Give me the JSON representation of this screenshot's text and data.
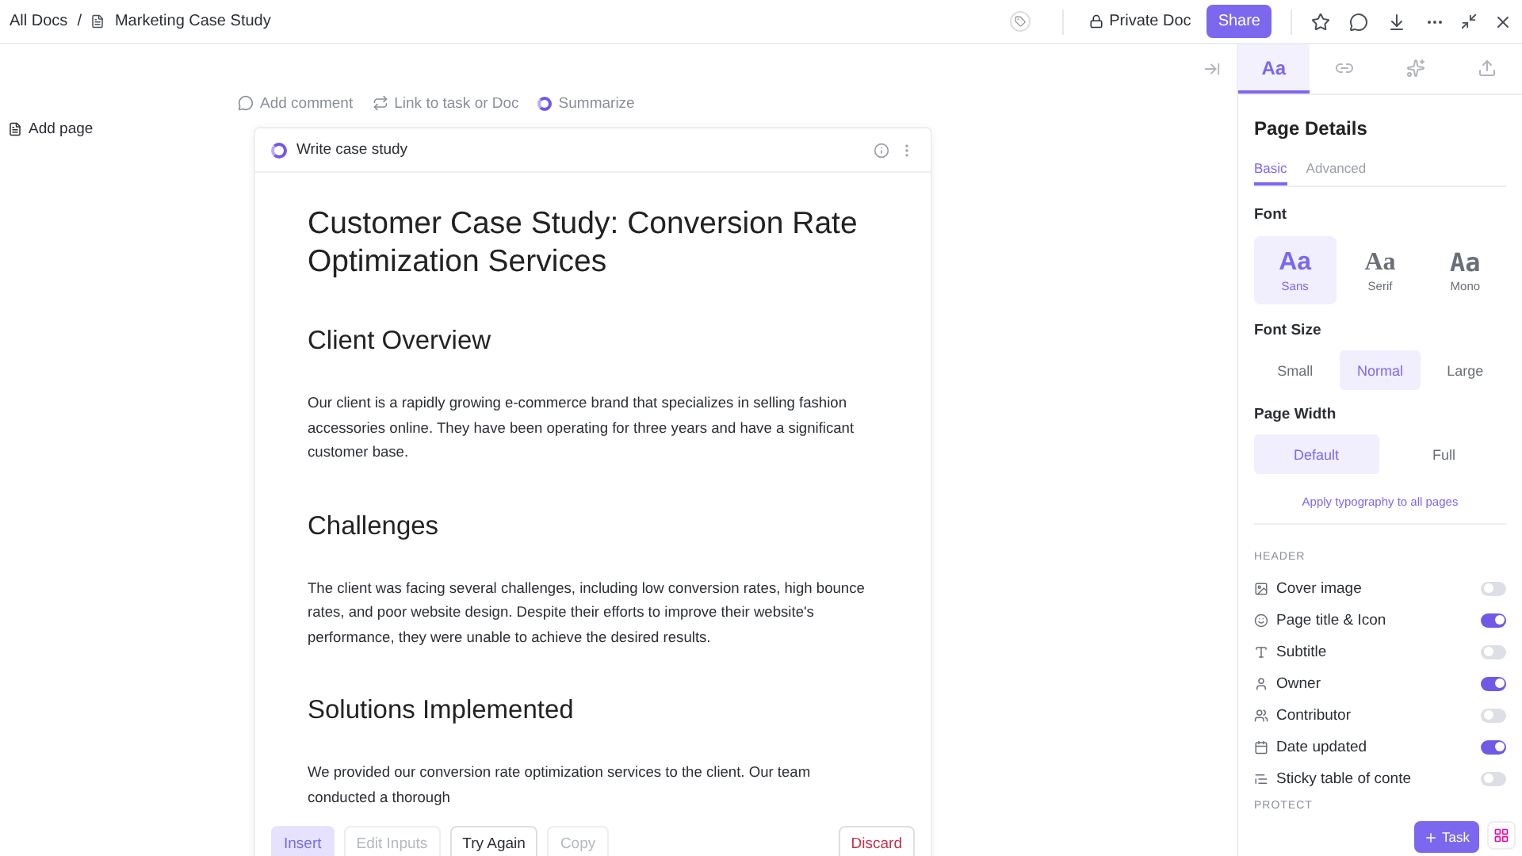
{
  "breadcrumb": {
    "root": "All Docs",
    "separator": "/",
    "doc": "Marketing Case Study"
  },
  "header_actions": {
    "privacy": "Private Doc",
    "share": "Share"
  },
  "sidebar": {
    "add_page": "Add page"
  },
  "doc_toolbar": [
    {
      "label": "Add comment",
      "kind": "comment"
    },
    {
      "label": "Link to task or Doc",
      "kind": "link"
    },
    {
      "label": "Summarize",
      "kind": "ai"
    }
  ],
  "ai_card": {
    "title": "Write case study",
    "document": {
      "title": "Customer Case Study: Conversion Rate Optimization Services",
      "sections": [
        {
          "heading": "Client Overview",
          "body": "Our client is a rapidly growing e-commerce brand that specializes in selling fashion accessories online. They have been operating for three years and have a significant customer base."
        },
        {
          "heading": "Challenges",
          "body": "The client was facing several challenges, including low conversion rates, high bounce rates, and poor website design. Despite their efforts to improve their website's performance, they were unable to achieve the desired results."
        },
        {
          "heading": "Solutions Implemented",
          "body": "We provided our conversion rate optimization services to the client. Our team conducted a thorough"
        }
      ]
    },
    "actions": [
      {
        "label": "Insert",
        "kind": "primary",
        "disabled": true
      },
      {
        "label": "Edit Inputs",
        "kind": "plain",
        "disabled": true
      },
      {
        "label": "Try Again",
        "kind": "plain",
        "disabled": false
      },
      {
        "label": "Copy",
        "kind": "plain",
        "disabled": true
      },
      {
        "label": "Discard",
        "kind": "danger",
        "disabled": false
      }
    ]
  },
  "panel": {
    "tabs": [
      {
        "kind": "text",
        "label": "Aa",
        "selected": true
      },
      {
        "kind": "link",
        "selected": false
      },
      {
        "kind": "sparkle",
        "selected": false
      },
      {
        "kind": "export",
        "selected": false
      }
    ],
    "title": "Page Details",
    "subtabs": [
      {
        "label": "Basic",
        "selected": true
      },
      {
        "label": "Advanced",
        "selected": false
      }
    ],
    "font": {
      "label": "Font",
      "options": [
        {
          "sample": "Aa",
          "label": "Sans",
          "kind": "sans",
          "selected": true
        },
        {
          "sample": "Aa",
          "label": "Serif",
          "kind": "serif",
          "selected": false
        },
        {
          "sample": "Aa",
          "label": "Mono",
          "kind": "mono",
          "selected": false
        }
      ]
    },
    "font_size": {
      "label": "Font Size",
      "options": [
        {
          "label": "Small",
          "selected": false
        },
        {
          "label": "Normal",
          "selected": true
        },
        {
          "label": "Large",
          "selected": false
        }
      ]
    },
    "page_width": {
      "label": "Page Width",
      "options": [
        {
          "label": "Default",
          "selected": true
        },
        {
          "label": "Full",
          "selected": false
        }
      ]
    },
    "apply_link": "Apply typography to all pages",
    "header_section": {
      "label": "HEADER",
      "items": [
        {
          "label": "Cover image",
          "kind": "image",
          "on": false
        },
        {
          "label": "Page title & Icon",
          "kind": "smile",
          "on": true
        },
        {
          "label": "Subtitle",
          "kind": "type",
          "on": false
        },
        {
          "label": "Owner",
          "kind": "user",
          "on": true
        },
        {
          "label": "Contributor",
          "kind": "users",
          "on": false
        },
        {
          "label": "Date updated",
          "kind": "calendar",
          "on": true
        },
        {
          "label": "Sticky table of conte",
          "kind": "list",
          "on": false
        }
      ]
    },
    "next_section": "PROTECT"
  },
  "floating": {
    "task": "Task"
  }
}
